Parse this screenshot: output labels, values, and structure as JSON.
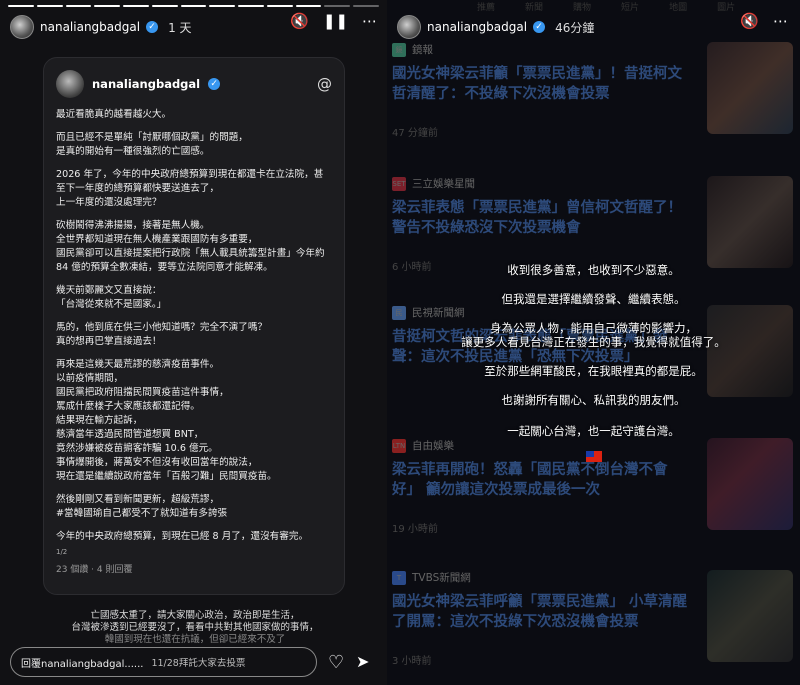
{
  "left": {
    "progress": [
      true,
      true,
      true,
      true,
      true,
      true,
      true,
      true,
      true,
      true,
      true,
      false,
      false
    ],
    "header": {
      "username": "nanaliangbadgal",
      "time": "1 天"
    },
    "card": {
      "username": "nanaliangbadgal",
      "paragraphs": [
        [
          "最近看脆真的越看越火大。"
        ],
        [
          "而且已經不是單純「討厭哪個政黨」的問題，",
          "是真的開始有一種很強烈的亡國感。"
        ],
        [
          "2026 年了，今年的中央政府總預算到現在都還卡在立法院，甚",
          "至下一年度的總預算都快要送進去了，",
          "上一年度的還沒處理完？"
        ],
        [
          "砍樹鬧得沸沸揚揚，接著是無人機。",
          "全世界都知道現在無人機產業跟國防有多重要，",
          "國民黨卻可以直接提案把行政院「無人載具統籌型計畫」今年約",
          "84 億的預算全數凍結，要等立法院同意才能解凍。"
        ],
        [
          "幾天前鄭麗文又直接說：",
          "「台灣從來就不是國家。」"
        ],
        [
          "馬的，他到底在供三小他知道嗎？完全不演了嗎？",
          "真的想再巴掌直接過去！"
        ],
        [
          "再來是這幾天最荒謬的慈濟疫苗事件。",
          "以前疫情期間，",
          "國民黨把政府阻擋民間買疫苗這件事情，",
          "罵成什麼樣子大家應該都還記得。",
          "結果現在輸方起訴，",
          "慈濟當年透過民間管道想買 BNT，",
          "竟然涉嫌被疫苗掮客詐騙 10.6 億元。",
          "事情爆開後，蔣萬安不但沒有收回當年的說法，",
          "現在還是繼續說政府當年「百般刁難」民間買疫苗。"
        ],
        [
          "然後剛剛又看到新聞更新，超級荒謬，",
          "#當韓國瑜自己都受不了就知道有多誇張"
        ],
        [
          "今年的中央政府總預算，到現在已經 8 月了，還沒有審完。"
        ]
      ],
      "pager": "1/2",
      "stats": "23 個讚 · 4 則回覆"
    },
    "caption": [
      "亡國感太重了，請大家關心政治，政治即是生活，",
      "台灣被滲透到已經要沒了，看看中共對其他國家做的事情，",
      "韓國到現在也還在抗議，但卻已經來不及了"
    ],
    "reply": {
      "label": "回覆nanaliangbadgal......",
      "overlay": "11/28拜託大家去投票"
    }
  },
  "right": {
    "header": {
      "username": "nanaliangbadgal",
      "time": "46分鐘"
    },
    "tabs": [
      "推薦",
      "新聞",
      "購物",
      "短片",
      "地圖",
      "圖片"
    ],
    "news": [
      {
        "source": "鏡報",
        "logo": "鏡",
        "logo_color": "#2f6f5a",
        "headline": "國光女神梁云菲籲「票票民進黨」！昔挺柯文哲清醒了：不投綠下次沒機會投票",
        "ago": "47 分鐘前"
      },
      {
        "source": "三立娛樂星聞",
        "logo": "SET",
        "logo_color": "#7a1f2a",
        "headline": "梁云菲表態「票票民進黨」曾信柯文哲醒了！警告不投綠恐沒下次投票機會",
        "ago": "6 小時前"
      },
      {
        "source": "民視新聞網",
        "logo": "民",
        "logo_color": "#3a5a8a",
        "headline": "昔挺柯文哲的梁云菲表態「票票民進黨」發聲：這次不投民進黨「恐無下次投票」",
        "ago": ""
      },
      {
        "source": "自由娛樂",
        "logo": "LTN",
        "logo_color": "#8a2020",
        "headline": "梁云菲再開砲！怒轟「國民黨不倒台灣不會好」 籲勿讓這次投票成最後一次",
        "ago": "19 小時前"
      },
      {
        "source": "TVBS新聞網",
        "logo": "T",
        "logo_color": "#2a4a8a",
        "headline": "國光女神梁云菲呼籲「票票民進黨」 小草清醒了開罵：這次不投綠下次恐沒機會投票",
        "ago": "3 小時前"
      }
    ],
    "overlay_lines": [
      "收到很多善意，也收到不少惡意。",
      "但我還是選擇繼續發聲、繼續表態。",
      "身為公眾人物，能用自己微薄的影響力，",
      "讓更多人看見台灣正在發生的事，我覺得就值得了。",
      "至於那些網軍酸民，在我眼裡真的都是屁。",
      "也謝謝所有關心、私訊我的朋友們。",
      "一起關心台灣，也一起守護台灣。"
    ],
    "flag_icon": "taiwan-flag-icon"
  }
}
